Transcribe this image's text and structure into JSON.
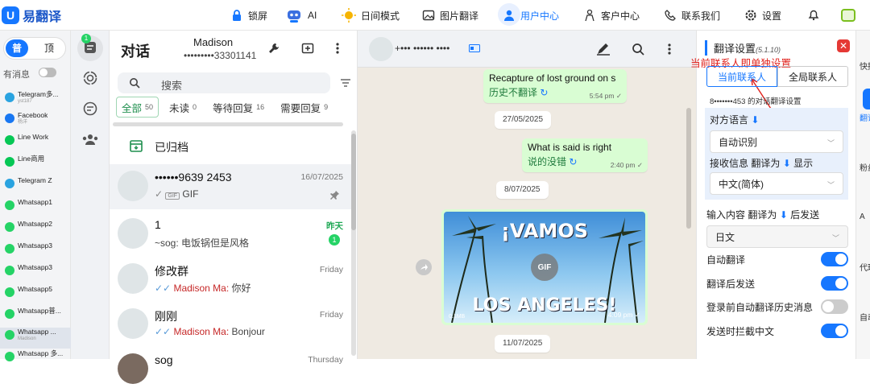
{
  "app": {
    "name": "易翻译",
    "logo": "U"
  },
  "topnav": [
    {
      "id": "lock",
      "label": "锁屏"
    },
    {
      "id": "ai",
      "label": "AI"
    },
    {
      "id": "day",
      "label": "日间模式"
    },
    {
      "id": "img",
      "label": "图片翻译"
    },
    {
      "id": "user",
      "label": "用户中心"
    },
    {
      "id": "cs",
      "label": "客户中心"
    },
    {
      "id": "contact",
      "label": "联系我们"
    },
    {
      "id": "settings",
      "label": "设置"
    }
  ],
  "sidebar": {
    "toggle_left": "普",
    "toggle_right": "顶",
    "has_msg_label": "有消息",
    "accounts": [
      {
        "name": "Telegram多...",
        "sub": "yst187",
        "color": "#2aa3e0"
      },
      {
        "name": "Facebook",
        "sub": "杨洋",
        "color": "#1877f2"
      },
      {
        "name": "Line Work",
        "sub": "",
        "color": "#06c755"
      },
      {
        "name": "Line商用",
        "sub": "",
        "color": "#06c755"
      },
      {
        "name": "Telegram Z",
        "sub": "",
        "color": "#2aa3e0"
      },
      {
        "name": "Whatsapp1",
        "sub": "",
        "color": "#25d366"
      },
      {
        "name": "Whatsapp2",
        "sub": "",
        "color": "#25d366"
      },
      {
        "name": "Whatsapp3",
        "sub": "",
        "color": "#25d366"
      },
      {
        "name": "Whatsapp3",
        "sub": "",
        "color": "#25d366"
      },
      {
        "name": "Whatsapp5",
        "sub": "",
        "color": "#25d366"
      },
      {
        "name": "Whatsapp普...",
        "sub": "",
        "color": "#25d366"
      },
      {
        "name": "Whatsapp ...",
        "sub": "Madison",
        "color": "#25d366"
      },
      {
        "name": "Whatsapp 多...",
        "sub": "",
        "color": "#25d366"
      }
    ],
    "rail_badge": "1"
  },
  "chatlist": {
    "title": "对话",
    "user": "Madison",
    "phone": "•••••••••33301141",
    "search_placeholder": "搜索",
    "tabs": [
      {
        "label": "全部",
        "count": "50"
      },
      {
        "label": "未读",
        "count": "0"
      },
      {
        "label": "等待回复",
        "count": "16"
      },
      {
        "label": "需要回复",
        "count": "9"
      }
    ],
    "archived": "已归档",
    "chats": [
      {
        "name": "••••••9639 2453",
        "time": "16/07/2025",
        "preview": "GIF",
        "gif_tag": "GIF"
      },
      {
        "name": "1",
        "time": "昨天",
        "preview": "~sog: 电饭锅但是风格",
        "unread": "1"
      },
      {
        "name": "修改群",
        "time": "Friday",
        "sender": "Madison Ma:",
        "preview": "你好"
      },
      {
        "name": "刚刚",
        "time": "Friday",
        "sender": "Madison Ma:",
        "preview": "Bonjour"
      },
      {
        "name": "sog",
        "time": "Thursday",
        "preview": ""
      }
    ]
  },
  "conversation": {
    "header_number": "+•••  ••••••  ••••",
    "messages": [
      {
        "text": "Recapture of lost ground on s",
        "translation": "历史不翻译",
        "time": "5:54 pm"
      },
      {
        "date": "27/05/2025"
      },
      {
        "text": "What is said is right",
        "translation": "说的没错",
        "time": "2:40 pm"
      },
      {
        "date": "8/07/2025"
      },
      {
        "image_top": "¡VAMOS",
        "image_bottom": "LOS ANGELES!",
        "gif": "GIF",
        "time": "4:09 pm",
        "image_tag": "0.1MB"
      },
      {
        "date": "11/07/2025"
      }
    ]
  },
  "settings": {
    "title": "翻译设置",
    "version": "(5.1.10)",
    "annotation": "当前联系人即单独设置",
    "seg_current": "当前联系人",
    "seg_global": "全局联系人",
    "contact_line": "8•••••••453  的对话翻译设置",
    "peer_lang_label": "对方语言",
    "peer_lang_value": "自动识别",
    "recv_label": "接收信息 翻译为",
    "recv_show": "显示",
    "recv_value": "中文(简体)",
    "input_label": "输入内容 翻译为",
    "input_send": "后发送",
    "input_value": "日文",
    "auto_translate": "自动翻译",
    "send_after": "翻译后发送",
    "history": "登录前自动翻译历史消息",
    "block_cn": "发送时拦截中文",
    "toggles": {
      "auto": true,
      "send_after": true,
      "history": false,
      "block": true
    }
  },
  "right_strip": [
    "快捷",
    "翻译",
    "粉丝",
    "A",
    "代理",
    "自动"
  ]
}
